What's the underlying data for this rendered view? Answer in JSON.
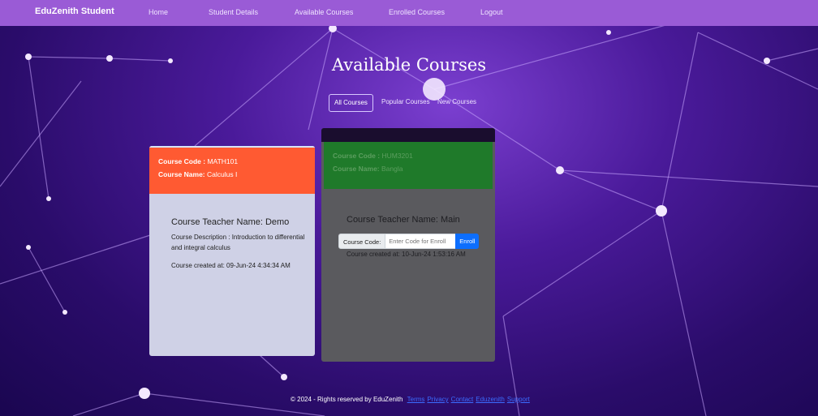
{
  "nav": {
    "brand": "EduZenith Student",
    "links": [
      "Home",
      "Student Details",
      "Available Courses",
      "Enrolled Courses",
      "Logout"
    ]
  },
  "page": {
    "title": "Available Courses"
  },
  "filters": [
    "All Courses",
    "Popular Courses",
    "New Courses"
  ],
  "courses": [
    {
      "code_label": "Course Code :",
      "code": "MATH101",
      "name_label": "Course Name:",
      "name": "Calculus I",
      "teacher": "Course Teacher Name: Demo",
      "description": "Course Description : Introduction to differential and integral calculus",
      "created": "Course created at: 09-Jun-24 4:34:34 AM",
      "header_color": "#ff5a32"
    },
    {
      "code_label": "Course Code :",
      "code": "HUM3201",
      "name_label": "Course Name:",
      "name": "Bangla",
      "teacher": "Course Teacher Name: Main",
      "description": "",
      "created": "Course created at: 10-Jun-24 1:53:16 AM",
      "header_color": "#1f7a2a"
    }
  ],
  "enroll": {
    "label": "Course Code:",
    "placeholder": "Enter Code for Enroll",
    "button": "Enroll"
  },
  "footer": {
    "text": "© 2024 - Rights reserved by EduZenith",
    "links": [
      "Terms",
      "Privacy",
      "Contact",
      "Eduzenith",
      "Support"
    ]
  }
}
